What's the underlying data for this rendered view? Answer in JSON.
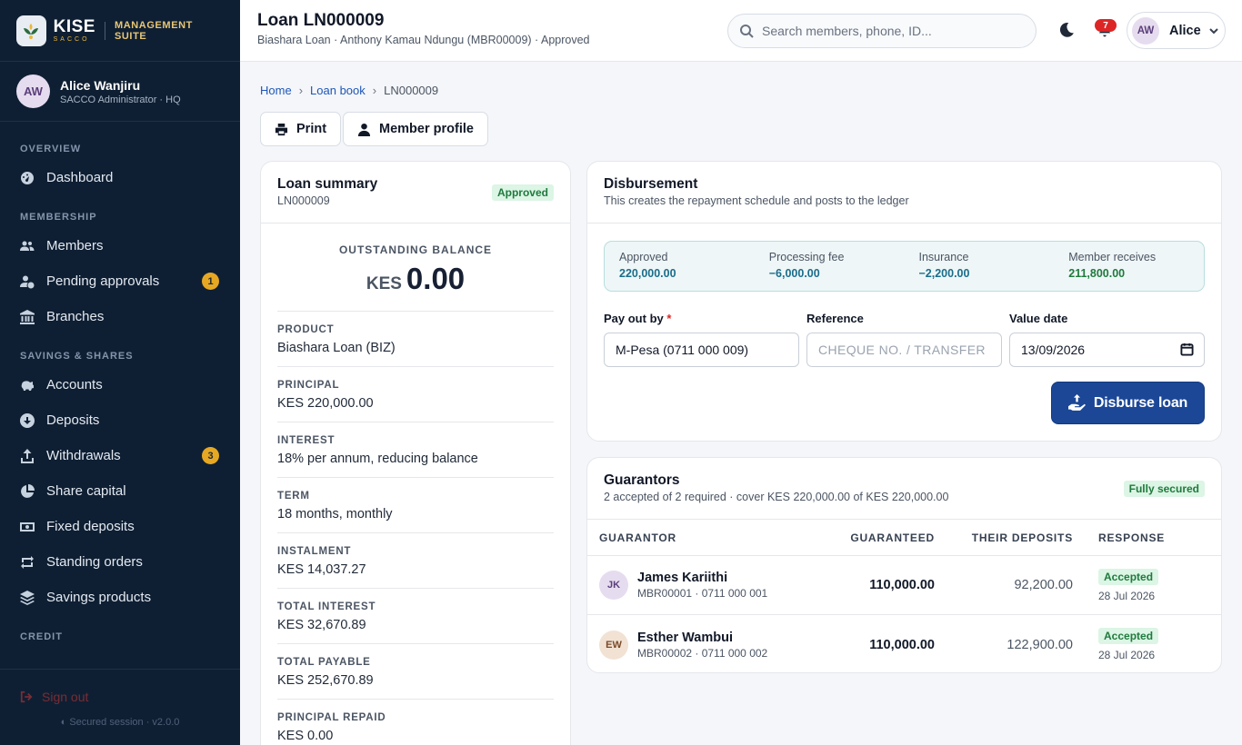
{
  "brand": {
    "name": "KISE",
    "tag": "SACCO",
    "suite": "MANAGEMENT SUITE"
  },
  "user": {
    "initials": "AW",
    "name": "Alice Wanjiru",
    "role": "SACCO Administrator · HQ",
    "short_name": "Alice"
  },
  "nav": {
    "overview_label": "OVERVIEW",
    "dashboard": "Dashboard",
    "membership_label": "MEMBERSHIP",
    "members": "Members",
    "pending": "Pending approvals",
    "pending_count": "1",
    "branches": "Branches",
    "savings_label": "SAVINGS & SHARES",
    "accounts": "Accounts",
    "deposits": "Deposits",
    "withdrawals": "Withdrawals",
    "withdrawals_count": "3",
    "share_capital": "Share capital",
    "fixed_deposits": "Fixed deposits",
    "standing_orders": "Standing orders",
    "savings_products": "Savings products",
    "credit_label": "CREDIT"
  },
  "footer": {
    "signout": "Sign out",
    "secure": "Secured session · v2.0.0"
  },
  "header": {
    "title": "Loan LN000009",
    "subtitle": "Biashara Loan · Anthony Kamau Ndungu (MBR00009) · Approved",
    "search_placeholder": "Search members, phone, ID...",
    "notif_count": "7"
  },
  "breadcrumb": {
    "home": "Home",
    "loan_book": "Loan book",
    "current": "LN000009"
  },
  "actions": {
    "print": "Print",
    "member_profile": "Member profile"
  },
  "summary": {
    "title": "Loan summary",
    "loan_id": "LN000009",
    "status": "Approved",
    "balance_label": "OUTSTANDING BALANCE",
    "balance_currency": "KES",
    "balance_value": "0.00",
    "fields": [
      {
        "label": "PRODUCT",
        "value": "Biashara Loan (BIZ)"
      },
      {
        "label": "PRINCIPAL",
        "value": "KES 220,000.00"
      },
      {
        "label": "INTEREST",
        "value": "18% per annum, reducing balance"
      },
      {
        "label": "TERM",
        "value": "18 months, monthly"
      },
      {
        "label": "INSTALMENT",
        "value": "KES 14,037.27"
      },
      {
        "label": "TOTAL INTEREST",
        "value": "KES 32,670.89"
      },
      {
        "label": "TOTAL PAYABLE",
        "value": "KES 252,670.89"
      },
      {
        "label": "PRINCIPAL REPAID",
        "value": "KES 0.00"
      }
    ]
  },
  "disbursement": {
    "title": "Disbursement",
    "subtitle": "This creates the repayment schedule and posts to the ledger",
    "breakdown": [
      {
        "label": "Approved",
        "value": "220,000.00",
        "color": "#1a6d8a"
      },
      {
        "label": "Processing fee",
        "value": "−6,000.00",
        "color": "#1a6d8a"
      },
      {
        "label": "Insurance",
        "value": "−2,200.00",
        "color": "#1a6d8a"
      },
      {
        "label": "Member receives",
        "value": "211,800.00",
        "color": "#1f7a3d"
      }
    ],
    "payout_label": "Pay out by",
    "payout_required": "*",
    "payout_value": "M-Pesa (0711 000 009)",
    "reference_label": "Reference",
    "reference_placeholder": "CHEQUE NO. / TRANSFER REF",
    "date_label": "Value date",
    "date_value": "13/09/2026",
    "button": "Disburse loan"
  },
  "guarantors": {
    "title": "Guarantors",
    "subtitle": "2 accepted of 2 required · cover KES 220,000.00 of KES 220,000.00",
    "status": "Fully secured",
    "columns": [
      "GUARANTOR",
      "GUARANTEED",
      "THEIR DEPOSITS",
      "RESPONSE"
    ],
    "rows": [
      {
        "initials": "JK",
        "name": "James Kariithi",
        "meta": "MBR00001 · 0711 000 001",
        "guaranteed": "110,000.00",
        "deposits": "92,200.00",
        "response": "Accepted",
        "date": "28 Jul 2026",
        "avatar_bg": "#e6dcef",
        "avatar_fg": "#5a3e7a"
      },
      {
        "initials": "EW",
        "name": "Esther Wambui",
        "meta": "MBR00002 · 0711 000 002",
        "guaranteed": "110,000.00",
        "deposits": "122,900.00",
        "response": "Accepted",
        "date": "28 Jul 2026",
        "avatar_bg": "#f1e2d4",
        "avatar_fg": "#7a4a28"
      }
    ]
  }
}
